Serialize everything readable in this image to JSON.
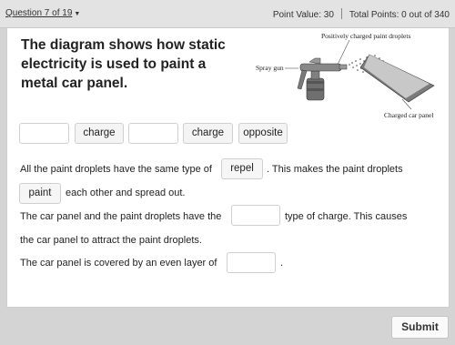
{
  "header": {
    "question_nav": "Question 7 of 19",
    "point_value": "Point Value: 30",
    "total_points": "Total Points: 0 out of 340"
  },
  "question": {
    "prompt": "The diagram shows how static electricity is used to paint a metal car panel."
  },
  "diagram": {
    "label_droplets": "Positively charged paint droplets",
    "label_gun": "Spray gun",
    "label_panel": "Charged car panel"
  },
  "word_bank": [
    "charge",
    "charge",
    "opposite"
  ],
  "sentences": {
    "s1_a": "All the paint droplets have the same type of",
    "s1_filled": "repel",
    "s1_b": ". This makes the paint droplets",
    "s2_filled": "paint",
    "s2_b": "each other and spread out.",
    "s3_a": "The car panel and the paint droplets have the",
    "s3_b": "type of charge. This causes",
    "s4": "the car panel to attract the paint droplets.",
    "s5_a": "The car panel is covered by an even layer of",
    "s5_b": "."
  },
  "footer": {
    "submit_label": "Submit"
  }
}
